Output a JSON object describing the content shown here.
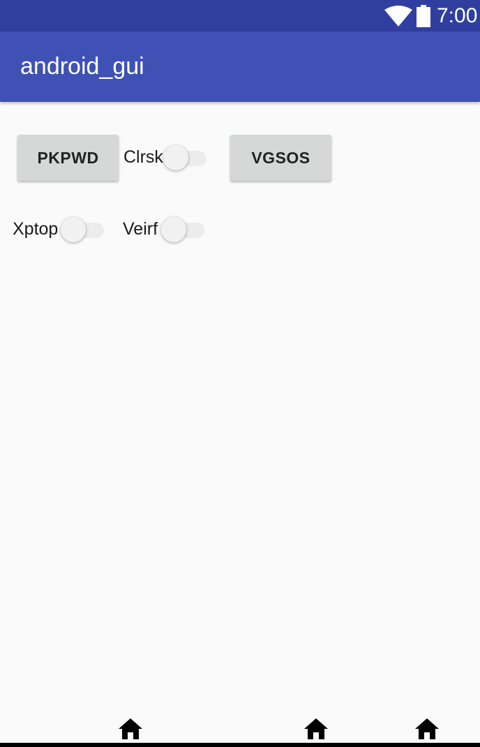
{
  "status_bar": {
    "time": "7:00",
    "icons": [
      "wifi-icon",
      "battery-icon"
    ]
  },
  "app_bar": {
    "title": "android_gui"
  },
  "content": {
    "button_1": "PKPWD",
    "switch_1_label": "Clrsk",
    "switch_1_checked": false,
    "button_2": "VGSOS",
    "switch_2_label": "Xptop",
    "switch_2_checked": false,
    "switch_3_label": "Veirf",
    "switch_3_checked": false
  },
  "nav_bar": {
    "icons": [
      "home-icon",
      "home-icon",
      "home-icon"
    ]
  },
  "colors": {
    "status_bar": "#303f9f",
    "app_bar": "#3f51b5",
    "background": "#fafafa",
    "button": "#d6d7d7"
  }
}
